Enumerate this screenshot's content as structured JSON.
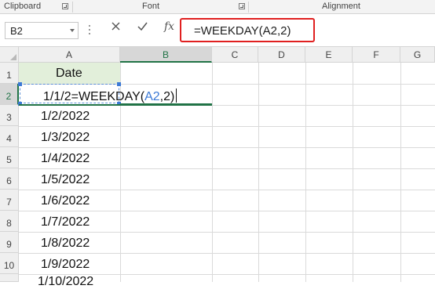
{
  "ribbon": {
    "groups": [
      "Clipboard",
      "Font",
      "Alignment"
    ]
  },
  "formula_bar": {
    "name_box": "B2",
    "cancel_icon": "x-icon",
    "enter_icon": "check-icon",
    "fx_label": "fx",
    "formula": "=WEEKDAY(A2,2)"
  },
  "columns": [
    "A",
    "B",
    "C",
    "D",
    "E",
    "F",
    "G"
  ],
  "rows": [
    "1",
    "2",
    "3",
    "4",
    "5",
    "6",
    "7",
    "8",
    "9",
    "10"
  ],
  "cells": {
    "A1": "Date",
    "A2": "1/1/2",
    "A3": "1/2/2022",
    "A4": "1/3/2022",
    "A5": "1/4/2022",
    "A6": "1/5/2022",
    "A7": "1/6/2022",
    "A8": "1/7/2022",
    "A9": "1/8/2022",
    "A10": "1/9/2022",
    "A11": "1/10/2022"
  },
  "editing": {
    "prefix": "=WEEKDAY(",
    "ref": "A2",
    "suffix": ",2)"
  },
  "colors": {
    "accent": "#217346",
    "highlight": "#e02020",
    "reference": "#3b79d6",
    "header_fill": "#e2efda"
  }
}
